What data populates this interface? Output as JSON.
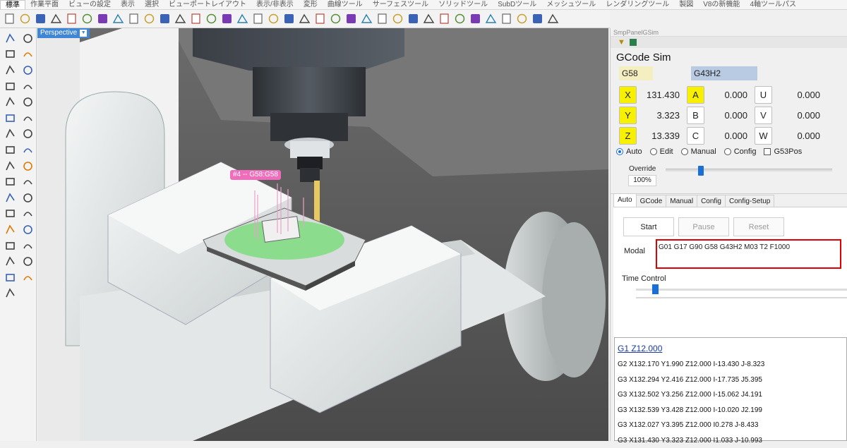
{
  "menu_tabs": [
    "標準",
    "作業平面",
    "ビューの設定",
    "表示",
    "選択",
    "ビューポートレイアウト",
    "表示/非表示",
    "変形",
    "曲線ツール",
    "サーフェスツール",
    "ソリッドツール",
    "SubDツール",
    "メッシュツール",
    "レンダリングツール",
    "製図",
    "V8の新機能",
    "4軸ツールパス"
  ],
  "viewport": {
    "title": "Perspective",
    "tool_label": "#4 -- G58:G58"
  },
  "panel": {
    "caption": "SmpPanelGSim",
    "title": "GCode Sim",
    "wcs": "G58",
    "tool_offset": "G43H2",
    "axes": {
      "x": {
        "label": "X",
        "value": "131.430"
      },
      "y": {
        "label": "Y",
        "value": "3.323"
      },
      "z": {
        "label": "Z",
        "value": "13.339"
      },
      "a": {
        "label": "A",
        "value": "0.000"
      },
      "b": {
        "label": "B",
        "value": "0.000"
      },
      "c": {
        "label": "C",
        "value": "0.000"
      },
      "u": {
        "label": "U",
        "value": "0.000"
      },
      "v": {
        "label": "V",
        "value": "0.000"
      },
      "w": {
        "label": "W",
        "value": "0.000"
      }
    },
    "modes": {
      "auto": "Auto",
      "edit": "Edit",
      "manual": "Manual",
      "config": "Config",
      "g53pos": "G53Pos",
      "selected": "Auto"
    },
    "override": {
      "label": "Override",
      "value": "100%",
      "level_fraction": 0.2
    },
    "tabs": [
      "Auto",
      "GCode",
      "Manual",
      "Config",
      "Config-Setup"
    ],
    "active_tab": "Auto",
    "buttons": {
      "start": "Start",
      "pause": "Pause",
      "reset": "Reset"
    },
    "modal_label": "Modal",
    "modal_text": "G01 G17 G90 G58 G43H2 M03 T2 F1000",
    "time_control_label": "Time Control",
    "time_fraction": 0.08
  },
  "gcode": {
    "current": "G1 Z12.000",
    "lines": [
      "G2 X132.170 Y1.990 Z12.000 I-13.430 J-8.323",
      "G3 X132.294 Y2.416 Z12.000 I-17.735 J5.395",
      "G3 X132.502 Y3.256 Z12.000 I-15.062 J4.191",
      "G3 X132.539 Y3.428 Z12.000 I-10.020 J2.199",
      "G3 X132.027 Y3.395 Z12.000 I0.278 J-8.433",
      "G3 X131.430 Y3.323 Z12.000 I1.033 J-10.993"
    ]
  },
  "colors": {
    "accent": "#1a6ed8",
    "axis_highlight": "#f7f000",
    "modal_border": "#e00000",
    "tool_label": "#f06dbb"
  }
}
